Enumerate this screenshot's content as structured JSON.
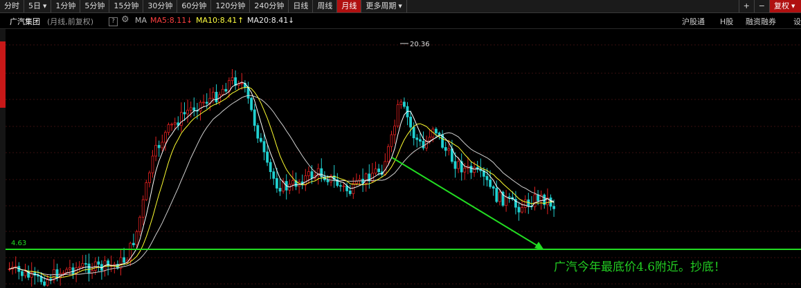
{
  "toolbar": {
    "tabs": [
      {
        "label": "分时"
      },
      {
        "label": "5日",
        "dropdown": true
      },
      {
        "label": "1分钟"
      },
      {
        "label": "5分钟"
      },
      {
        "label": "15分钟"
      },
      {
        "label": "30分钟"
      },
      {
        "label": "60分钟"
      },
      {
        "label": "120分钟"
      },
      {
        "label": "240分钟"
      },
      {
        "label": "日线"
      },
      {
        "label": "周线"
      },
      {
        "label": "月线",
        "active": true
      },
      {
        "label": "更多周期",
        "dropdown": true
      }
    ],
    "right": {
      "plus": "+",
      "minus": "−",
      "adjust_label": "复权"
    }
  },
  "infobar": {
    "stock_name": "广汽集团",
    "period_desc": "(月线,前复权)",
    "help": "?",
    "ma_label": "MA",
    "ma5": "MA5:8.11",
    "ma10": "MA10:8.41",
    "ma20": "MA20:8.41",
    "right_links": [
      "沪股通",
      "H股",
      "融资融券",
      "设"
    ]
  },
  "colors": {
    "up": "#e02020",
    "down": "#20d0d0",
    "ma5": "#ffffff",
    "ma10": "#ffff30",
    "ma20": "#d0d0d0",
    "annotation": "#22dd22",
    "accent": "#b01010"
  },
  "annotations": {
    "high_label": "20.36",
    "low_label": "4.63",
    "comment": "广汽今年最底价4.6附近。抄底！"
  },
  "chart_data": {
    "type": "candlestick",
    "series": [
      "MA5",
      "MA10",
      "MA20"
    ],
    "marked_high": 20.36,
    "marked_low": 4.63,
    "support_level": 4.63,
    "grid": true
  }
}
